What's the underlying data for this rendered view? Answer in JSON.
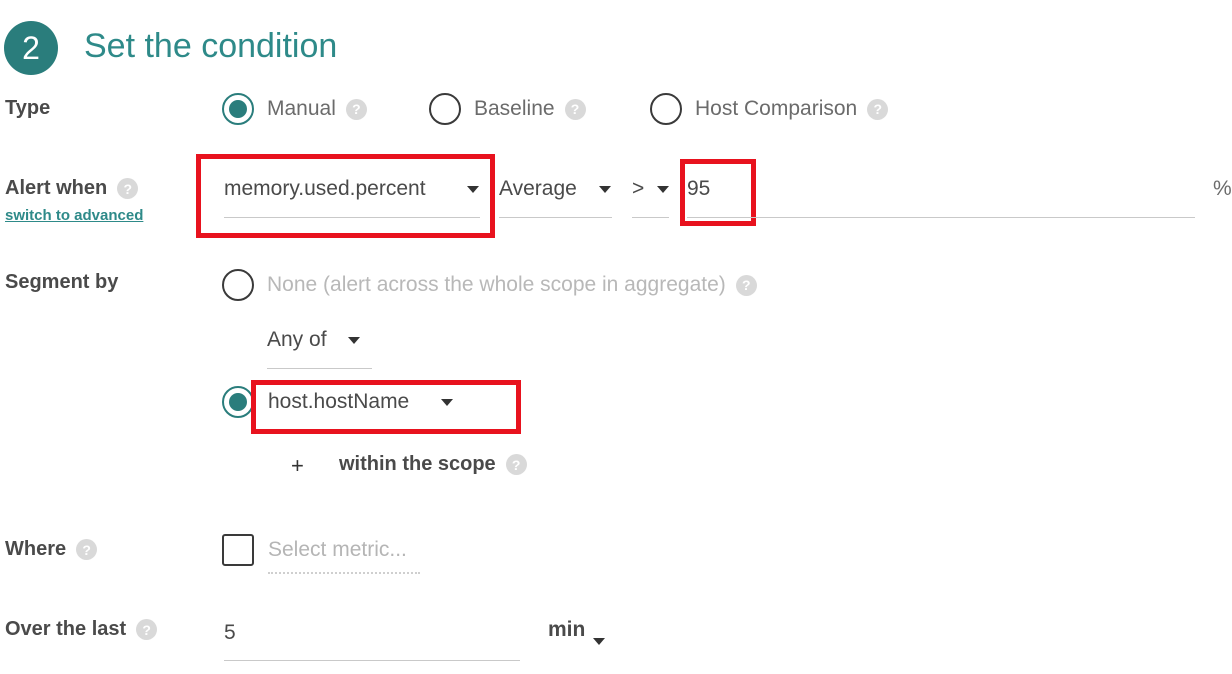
{
  "step": {
    "number": "2",
    "title": "Set the condition"
  },
  "type_row": {
    "label": "Type",
    "options": [
      {
        "label": "Manual",
        "checked": true
      },
      {
        "label": "Baseline",
        "checked": false
      },
      {
        "label": "Host Comparison",
        "checked": false
      }
    ]
  },
  "alert_row": {
    "label": "Alert when",
    "switch_link": "switch to advanced",
    "metric": "memory.used.percent",
    "aggregation": "Average",
    "operator": ">",
    "threshold": "95",
    "unit": "%"
  },
  "segment_row": {
    "label": "Segment by",
    "none_option": "None (alert across the whole scope in aggregate)",
    "any_of": "Any of",
    "segment_value": "host.hostName",
    "add_symbol": "+",
    "within_scope": "within the scope"
  },
  "where_row": {
    "label": "Where",
    "placeholder": "Select metric..."
  },
  "duration_row": {
    "label": "Over the last",
    "value": "5",
    "unit": "min"
  },
  "icons": {
    "help": "?"
  },
  "colors": {
    "accent": "#2a7d7c",
    "highlight": "#e8121e"
  }
}
